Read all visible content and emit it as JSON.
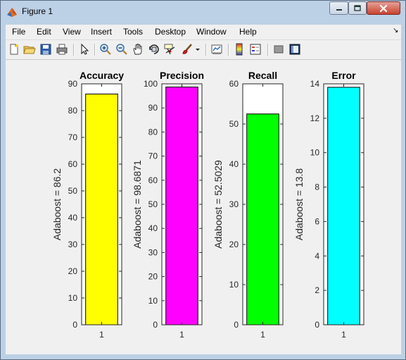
{
  "window": {
    "title": "Figure 1",
    "icon": "matlab-figure-icon",
    "controls": [
      "minimize-icon",
      "maximize-icon",
      "close-icon"
    ]
  },
  "menubar": {
    "items": [
      {
        "label": "File"
      },
      {
        "label": "Edit"
      },
      {
        "label": "View"
      },
      {
        "label": "Insert"
      },
      {
        "label": "Tools"
      },
      {
        "label": "Desktop"
      },
      {
        "label": "Window"
      },
      {
        "label": "Help"
      }
    ]
  },
  "toolbar": {
    "buttons": [
      "new-figure-icon",
      "open-file-icon",
      "save-icon",
      "print-icon",
      "edit-plot-arrow-icon",
      "zoom-in-icon",
      "zoom-out-icon",
      "pan-hand-icon",
      "rotate-3d-icon",
      "data-cursor-icon",
      "brush-icon",
      "brush-dropdown-icon",
      "link-plot-icon",
      "insert-colorbar-icon",
      "insert-legend-icon",
      "hide-plot-tools-icon",
      "show-plot-tools-icon"
    ]
  },
  "chart_data": [
    {
      "type": "bar",
      "title": "Accuracy",
      "categories": [
        "1"
      ],
      "series": [
        {
          "values": [
            86.2
          ],
          "color": "#ffff00"
        }
      ],
      "ylabel": "Adaboost  = 86.2",
      "ylim": [
        0,
        90
      ],
      "yticks": [
        "0",
        "10",
        "20",
        "30",
        "40",
        "50",
        "60",
        "70",
        "80",
        "90"
      ],
      "grid": false
    },
    {
      "type": "bar",
      "title": "Precision",
      "categories": [
        "1"
      ],
      "series": [
        {
          "values": [
            98.6871
          ],
          "color": "#ff00ff"
        }
      ],
      "ylabel": "Adaboost  = 98.6871",
      "ylim": [
        0,
        100
      ],
      "yticks": [
        "0",
        "10",
        "20",
        "30",
        "40",
        "50",
        "60",
        "70",
        "80",
        "90",
        "100"
      ],
      "grid": false
    },
    {
      "type": "bar",
      "title": "Recall",
      "categories": [
        "1"
      ],
      "series": [
        {
          "values": [
            52.5029
          ],
          "color": "#00ff00"
        }
      ],
      "ylabel": "Adaboost  = 52.5029",
      "ylim": [
        0,
        60
      ],
      "yticks": [
        "0",
        "10",
        "20",
        "30",
        "40",
        "50",
        "60"
      ],
      "grid": false
    },
    {
      "type": "bar",
      "title": "Error",
      "categories": [
        "1"
      ],
      "series": [
        {
          "values": [
            13.8
          ],
          "color": "#00ffff"
        }
      ],
      "ylabel": "Adaboost  = 13.8",
      "ylim": [
        0,
        14
      ],
      "yticks": [
        "0",
        "2",
        "4",
        "6",
        "8",
        "10",
        "12",
        "14"
      ],
      "grid": false
    }
  ]
}
